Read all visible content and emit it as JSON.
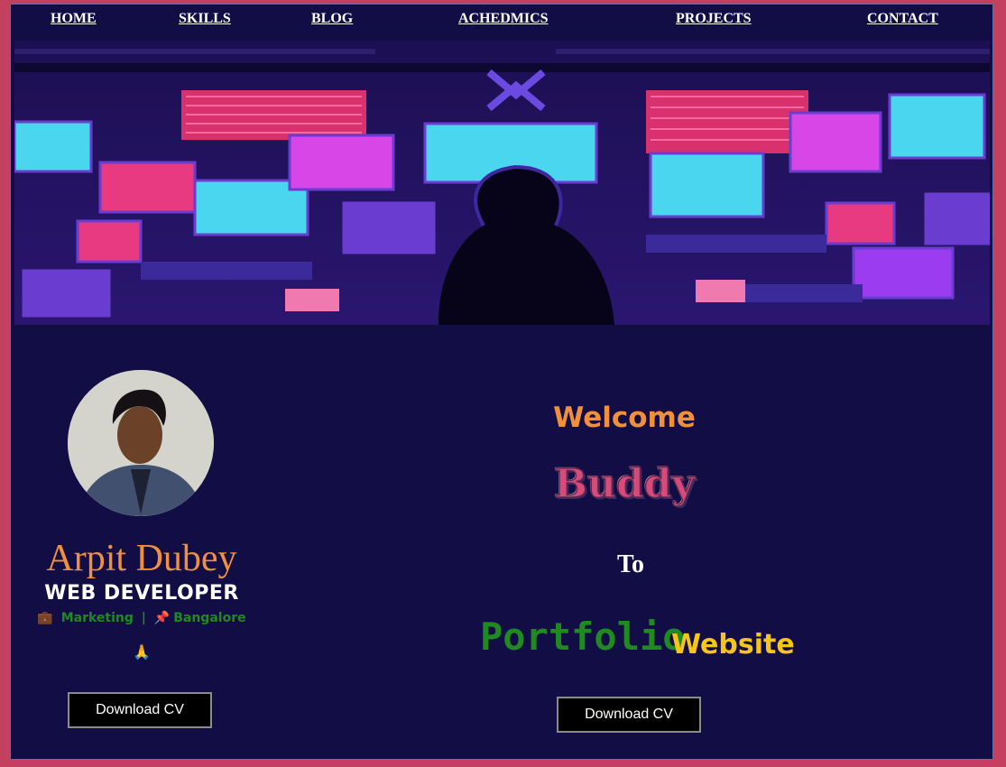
{
  "nav": {
    "items": [
      {
        "label": "HOME"
      },
      {
        "label": "SKILLS"
      },
      {
        "label": "BLOG"
      },
      {
        "label": "ACHEDMICS"
      },
      {
        "label": "PROJECTS"
      },
      {
        "label": "CONTACT"
      }
    ]
  },
  "banner": {
    "image": "pixel-art-hacker-with-monitors"
  },
  "profile": {
    "avatar": "profile-photo",
    "name": "Arpit Dubey",
    "role": "WEB DEVELOPER",
    "meta": {
      "briefcase_icon": "💼",
      "field": "Marketing",
      "separator": "|",
      "pin_icon": "📌",
      "location": "Bangalore"
    },
    "pray_icon": "🙏",
    "download_label": "Download CV"
  },
  "hero": {
    "welcome": "Welcome",
    "buddy": "Buddy",
    "to": "To",
    "portfolio": "Portfolio",
    "website": "Website",
    "download_label": "Download CV"
  },
  "colors": {
    "background_outer": "#c4405e",
    "background_inner": "#120d45",
    "orange": "#f0903c",
    "green": "#1e8a20",
    "yellow": "#f5c518"
  }
}
